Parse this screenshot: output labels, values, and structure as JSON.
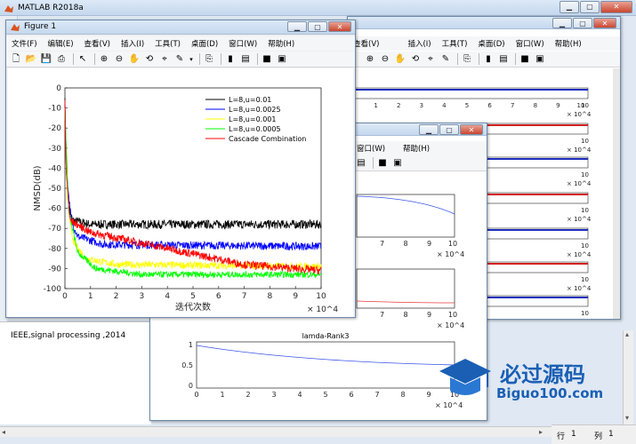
{
  "main_window": {
    "title": "MATLAB R2018a"
  },
  "figure1": {
    "title": "Figure 1",
    "menu": [
      "文件(F)",
      "编辑(E)",
      "查看(V)",
      "插入(I)",
      "工具(T)",
      "桌面(D)",
      "窗口(W)",
      "帮助(H)"
    ]
  },
  "figure_back": {
    "menu": [
      "查看(V)",
      "插入(I)",
      "工具(T)",
      "桌面(D)",
      "窗口(W)",
      "帮助(H)"
    ]
  },
  "figure_mid": {
    "menu": [
      "窗口(W)",
      "帮助(H)"
    ],
    "subplot3_title": "lamda-Rank3"
  },
  "editor": {
    "text_line": "IEEE,signal processing ,2014",
    "status_row_label": "行",
    "status_row": "1",
    "status_col_label": "列",
    "status_col": "1"
  },
  "watermark": {
    "brand": "必过源码",
    "url": "Biguo100.com"
  },
  "colors": {
    "black": "#000000",
    "blue": "#0000ff",
    "yellow": "#ffff00",
    "green": "#00ff00",
    "red": "#ff0000"
  },
  "chart_data": {
    "type": "line",
    "xlabel": "迭代次数",
    "ylabel": "NMSD(dB)",
    "x_exponent": "× 10^4",
    "xlim": [
      0,
      100000
    ],
    "ylim": [
      -100,
      0
    ],
    "xticks": [
      0,
      1,
      2,
      3,
      4,
      5,
      6,
      7,
      8,
      9,
      10
    ],
    "yticks": [
      0,
      -10,
      -20,
      -30,
      -40,
      -50,
      -60,
      -70,
      -80,
      -90,
      -100
    ],
    "series": [
      {
        "name": "L=8,u=0.01",
        "color": "#000000",
        "points": [
          [
            0,
            -5
          ],
          [
            500,
            -40
          ],
          [
            1500,
            -60
          ],
          [
            3000,
            -66
          ],
          [
            10000,
            -68
          ],
          [
            100000,
            -68
          ]
        ],
        "noise": 2.2
      },
      {
        "name": "L=8,u=0.0025",
        "color": "#0000ff",
        "points": [
          [
            0,
            -8
          ],
          [
            800,
            -45
          ],
          [
            2500,
            -66
          ],
          [
            5000,
            -74
          ],
          [
            15000,
            -78
          ],
          [
            100000,
            -79
          ]
        ],
        "noise": 2.0
      },
      {
        "name": "L=8,u=0.001",
        "color": "#ffff00",
        "points": [
          [
            0,
            -10
          ],
          [
            1000,
            -55
          ],
          [
            3000,
            -76
          ],
          [
            8000,
            -85
          ],
          [
            20000,
            -88
          ],
          [
            100000,
            -89
          ]
        ],
        "noise": 1.8
      },
      {
        "name": "L=8,u=0.0005",
        "color": "#00ff00",
        "points": [
          [
            0,
            -12
          ],
          [
            1500,
            -62
          ],
          [
            5000,
            -82
          ],
          [
            12000,
            -90
          ],
          [
            30000,
            -93
          ],
          [
            100000,
            -93
          ]
        ],
        "noise": 1.6
      },
      {
        "name": "Cascade Combination",
        "color": "#ff0000",
        "points": [
          [
            0,
            -6
          ],
          [
            500,
            -42
          ],
          [
            2000,
            -66
          ],
          [
            10000,
            -72
          ],
          [
            40000,
            -80
          ],
          [
            70000,
            -88
          ],
          [
            100000,
            -91
          ]
        ],
        "noise": 2.0
      }
    ]
  },
  "mid_chart": {
    "subplot1_xticks": [
      7,
      8,
      9,
      10
    ],
    "subplot2_xticks": [
      7,
      8,
      9,
      10
    ],
    "subplot3_xticks": [
      0,
      1,
      2,
      3,
      4,
      5,
      6,
      7,
      8,
      9,
      10
    ],
    "subplot3_yticks": [
      "1",
      "0.5",
      "0"
    ],
    "x_exponent": "× 10^4"
  },
  "back_chart": {
    "xticks": [
      1,
      2,
      3,
      4,
      5,
      6,
      7,
      8,
      9,
      10
    ],
    "x_exponent": "× 10^4"
  }
}
